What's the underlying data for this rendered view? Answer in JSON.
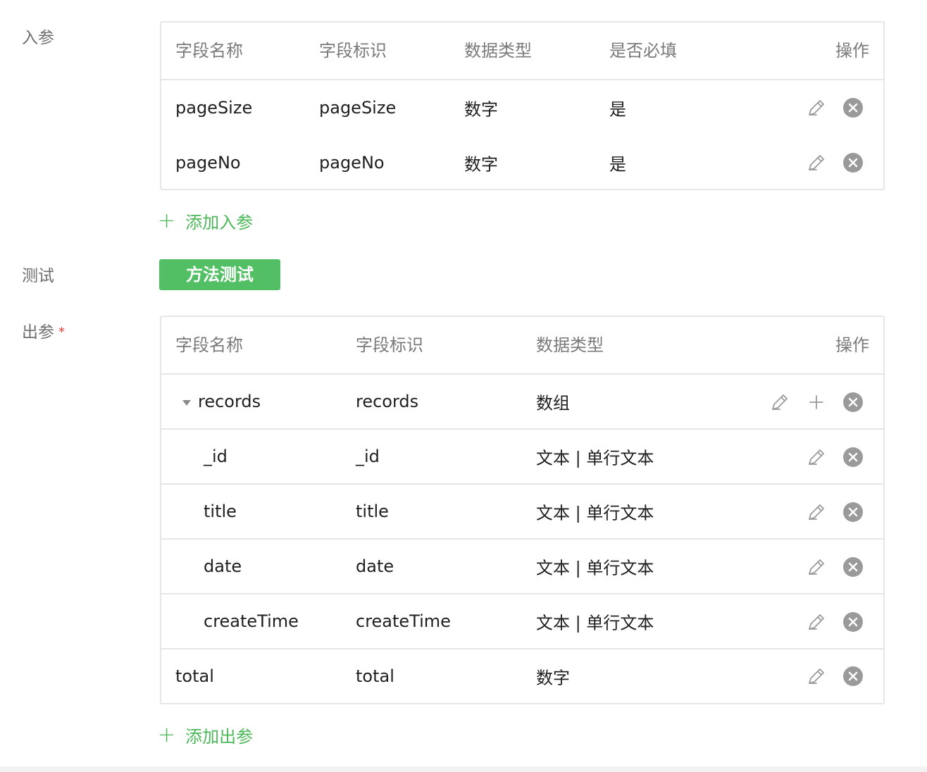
{
  "input_params": {
    "label": "入参",
    "columns": {
      "name": "字段名称",
      "identifier": "字段标识",
      "type": "数据类型",
      "required": "是否必填",
      "actions": "操作"
    },
    "rows": [
      {
        "name": "pageSize",
        "identifier": "pageSize",
        "type": "数字",
        "required": "是"
      },
      {
        "name": "pageNo",
        "identifier": "pageNo",
        "type": "数字",
        "required": "是"
      }
    ],
    "add_label": "添加入参"
  },
  "test": {
    "label": "测试",
    "button_label": "方法测试"
  },
  "output_params": {
    "label": "出参",
    "required_mark": "*",
    "columns": {
      "name": "字段名称",
      "identifier": "字段标识",
      "type": "数据类型",
      "actions": "操作"
    },
    "rows": [
      {
        "name": "records",
        "identifier": "records",
        "type": "数组"
      },
      {
        "name": "_id",
        "identifier": "_id",
        "type": "文本 | 单行文本"
      },
      {
        "name": "title",
        "identifier": "title",
        "type": "文本 | 单行文本"
      },
      {
        "name": "date",
        "identifier": "date",
        "type": "文本 | 单行文本"
      },
      {
        "name": "createTime",
        "identifier": "createTime",
        "type": "文本 | 单行文本"
      },
      {
        "name": "total",
        "identifier": "total",
        "type": "数字"
      }
    ],
    "add_label": "添加出参"
  },
  "icons": {
    "edit": "pencil-icon",
    "delete": "close-circle-icon",
    "add_child": "plus-icon",
    "expand": "caret-down-icon"
  },
  "colors": {
    "accent": "#52bf64",
    "link": "#4cb85a",
    "required": "#e0412f",
    "border": "#e6e6e6",
    "icon_gray": "#9a9a9a"
  }
}
